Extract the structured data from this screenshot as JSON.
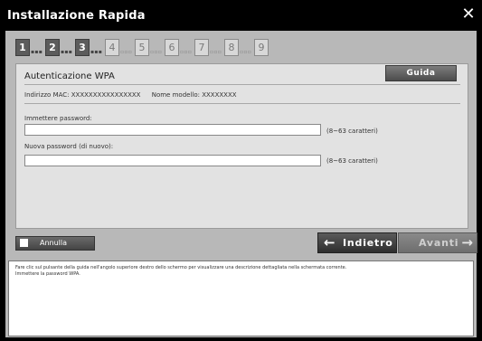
{
  "window": {
    "title": "Installazione Rapida"
  },
  "steps": [
    {
      "num": "1",
      "state": "done"
    },
    {
      "num": "2",
      "state": "done"
    },
    {
      "num": "3",
      "state": "done"
    },
    {
      "num": "4",
      "state": "todo"
    },
    {
      "num": "5",
      "state": "todo"
    },
    {
      "num": "6",
      "state": "todo"
    },
    {
      "num": "7",
      "state": "todo"
    },
    {
      "num": "8",
      "state": "todo"
    },
    {
      "num": "9",
      "state": "todo"
    }
  ],
  "panel": {
    "title": "Autenticazione WPA",
    "guide_label": "Guida",
    "mac_label": "Indirizzo MAC: XXXXXXXXXXXXXXXX",
    "model_label": "Nome modello: XXXXXXXX",
    "password_label": "Immettere password:",
    "password_value": "",
    "password_hint": "(8~63 caratteri)",
    "repeat_label": "Nuova password (di nuovo):",
    "repeat_value": "",
    "repeat_hint": "(8~63 caratteri)"
  },
  "footer": {
    "cancel_label": "Annulla",
    "back_label": "Indietro",
    "next_label": "Avanti"
  },
  "help": {
    "line1": "Fare clic sul pulsante della guida nell'angolo superiore destro dello schermo per visualizzare una descrizione dettagliata nella schermata corrente.",
    "line2": "Immettere la password WPA."
  }
}
